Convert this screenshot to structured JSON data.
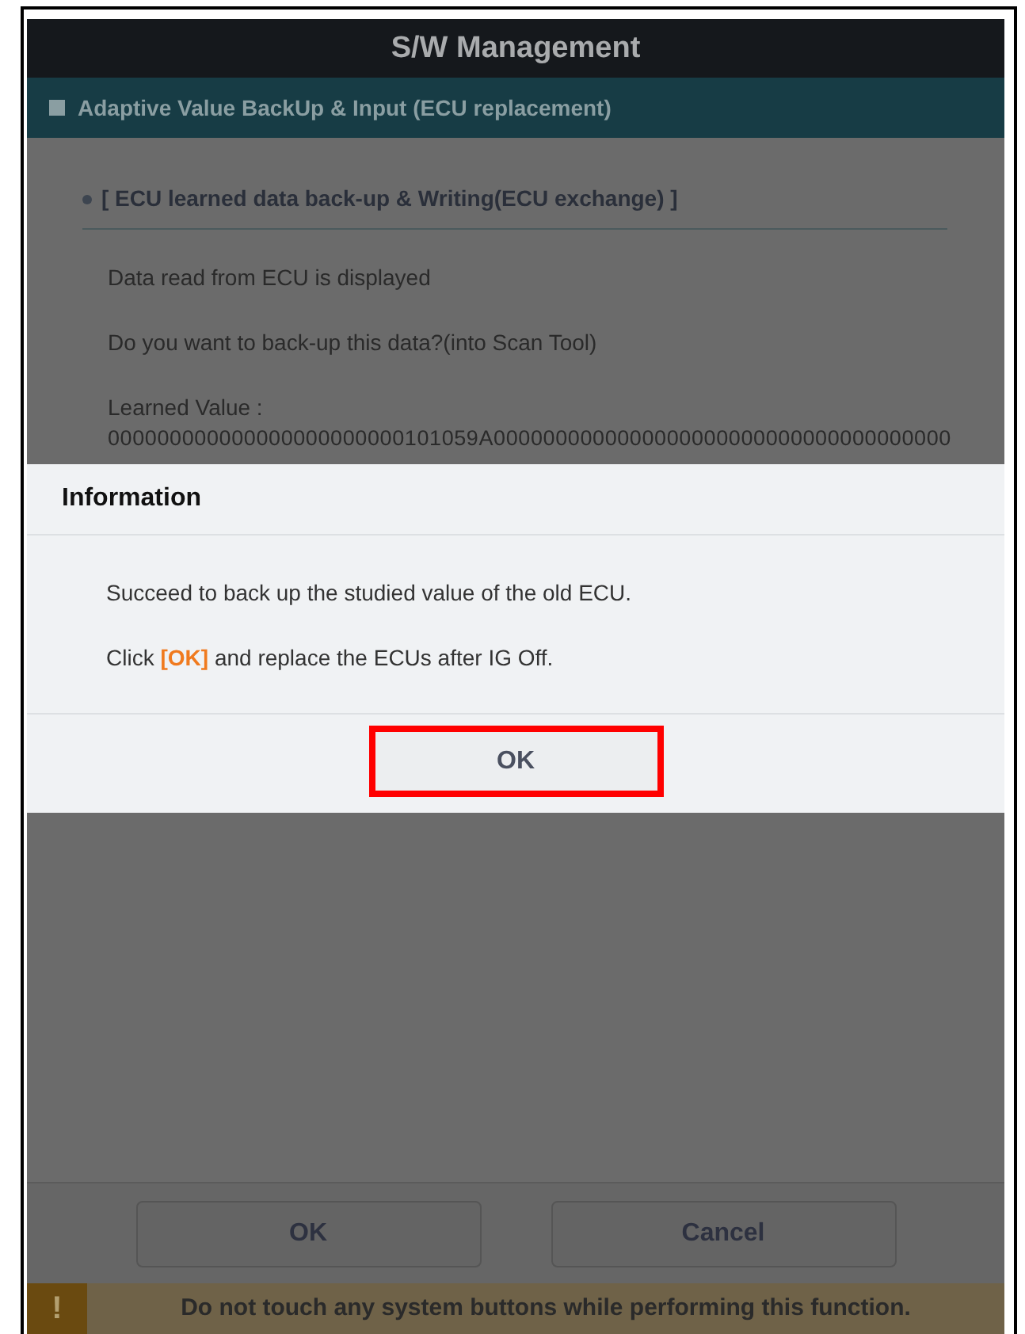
{
  "window": {
    "title": "S/W Management"
  },
  "section_bar": {
    "title": "Adaptive Value BackUp & Input (ECU replacement)"
  },
  "content": {
    "heading": "[ ECU learned data back-up & Writing(ECU exchange) ]",
    "lines": [
      "Data read from ECU is displayed",
      "Do you want to back-up this data?(into Scan Tool)",
      "Learned Value :"
    ],
    "value": "000000000000000000000000101059A0000000000000000000000000000000000000"
  },
  "dialog": {
    "title": "Information",
    "messages": [
      [
        {
          "text": "Succeed to back up the studied value of the old ECU.",
          "highlight": false
        }
      ],
      [
        {
          "text": "Click ",
          "highlight": false
        },
        {
          "text": "[OK]",
          "highlight": true
        },
        {
          "text": " and replace the ECUs after IG Off.",
          "highlight": false
        }
      ]
    ],
    "button": {
      "label": "OK",
      "highlighted": true
    }
  },
  "buttons": [
    "OK",
    "Cancel"
  ],
  "warning": {
    "icon": "!",
    "text": "Do not touch any system buttons while performing this function."
  }
}
